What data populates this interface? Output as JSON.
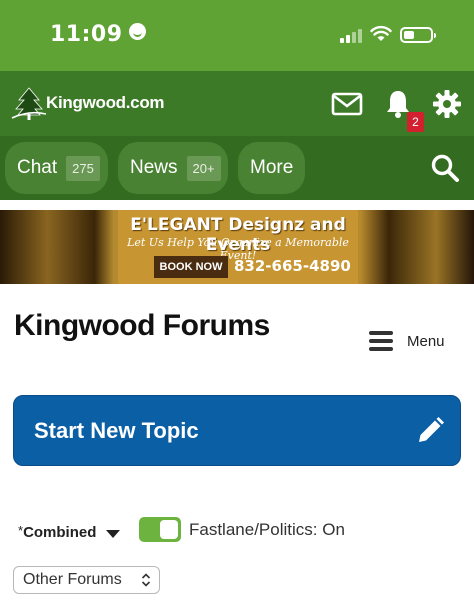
{
  "status_bar": {
    "time": "11:09"
  },
  "header": {
    "logo_text": "Kingwood.com",
    "notification_count": "2",
    "icons": [
      "mail-icon",
      "bell-icon",
      "gear-icon"
    ]
  },
  "nav": {
    "items": [
      {
        "label": "Chat",
        "count": "275"
      },
      {
        "label": "News",
        "count": "20+"
      },
      {
        "label": "More"
      }
    ],
    "search_icon": "search-icon"
  },
  "banner": {
    "title": "E'LEGANT Designz and Events",
    "subtitle": "Let Us Help You Organize a Memorable Event!",
    "cta": "BOOK NOW",
    "phone": "832-665-4890"
  },
  "page": {
    "title": "Kingwood Forums",
    "menu_label": "Menu",
    "new_topic_label": "Start New Topic"
  },
  "filters": {
    "combined_star": "*",
    "combined_label": "Combined",
    "toggle_label": "Fastlane/Politics: On",
    "toggle_on": true,
    "forum_select": "Other Forums"
  },
  "colors": {
    "status_bar": "#5fa334",
    "header": "#3d7a27",
    "nav": "#336b21",
    "primary_button": "#0b5fa5",
    "toggle": "#6db33f",
    "badge": "#d2202f"
  }
}
